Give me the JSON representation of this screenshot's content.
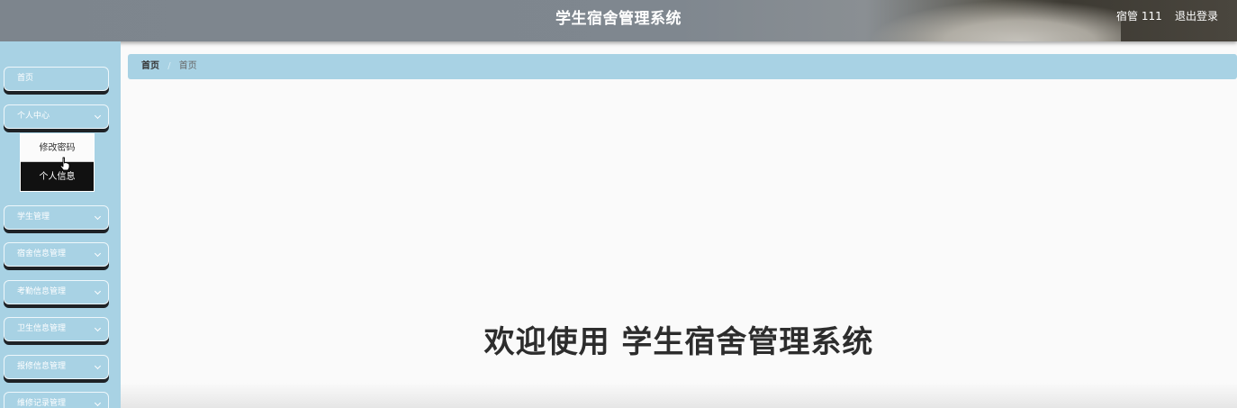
{
  "header": {
    "title": "学生宿舍管理系统",
    "user": "宿管 111",
    "logout": "退出登录"
  },
  "sidebar": {
    "items": [
      {
        "label": "首页"
      },
      {
        "label": "个人中心"
      },
      {
        "label": "学生管理"
      },
      {
        "label": "宿舍信息管理"
      },
      {
        "label": "考勤信息管理"
      },
      {
        "label": "卫生信息管理"
      },
      {
        "label": "报修信息管理"
      },
      {
        "label": "维修记录管理"
      }
    ],
    "submenu": {
      "items": [
        "修改密码",
        "个人信息"
      ]
    }
  },
  "breadcrumb": {
    "home": "首页",
    "separator": "/",
    "current": "首页"
  },
  "main": {
    "welcome": "欢迎使用 学生宿舍管理系统"
  },
  "colors": {
    "sidebar_bg": "#a8d2e4",
    "header_bg": "#7d858d",
    "menu_shadow": "#1e2226"
  }
}
